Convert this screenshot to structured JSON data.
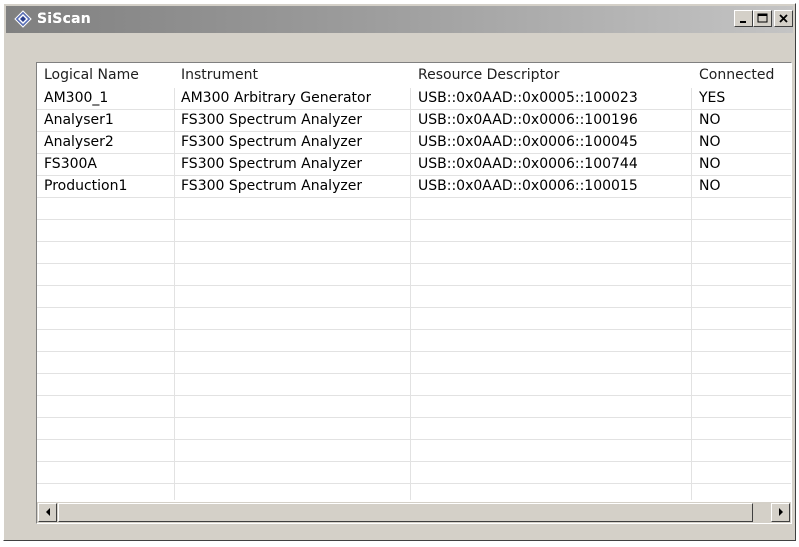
{
  "window": {
    "title": "SiScan"
  },
  "table": {
    "columns": [
      "Logical Name",
      "Instrument",
      "Resource Descriptor",
      "Connected"
    ],
    "rows": [
      [
        "AM300_1",
        "AM300 Arbitrary Generator",
        "USB::0x0AAD::0x0005::100023",
        "YES"
      ],
      [
        "Analyser1",
        "FS300 Spectrum Analyzer",
        "USB::0x0AAD::0x0006::100196",
        "NO"
      ],
      [
        "Analyser2",
        "FS300 Spectrum Analyzer",
        "USB::0x0AAD::0x0006::100045",
        "NO"
      ],
      [
        "FS300A",
        "FS300 Spectrum Analyzer",
        "USB::0x0AAD::0x0006::100744",
        "NO"
      ],
      [
        "Production1",
        "FS300 Spectrum Analyzer",
        "USB::0x0AAD::0x0006::100015",
        "NO"
      ]
    ]
  },
  "icons": {
    "app": "siscan-app-icon",
    "minimize": "minimize-icon",
    "maximize": "maximize-icon",
    "close": "close-icon",
    "scroll_left": "arrow-left-icon",
    "scroll_right": "arrow-right-icon"
  }
}
